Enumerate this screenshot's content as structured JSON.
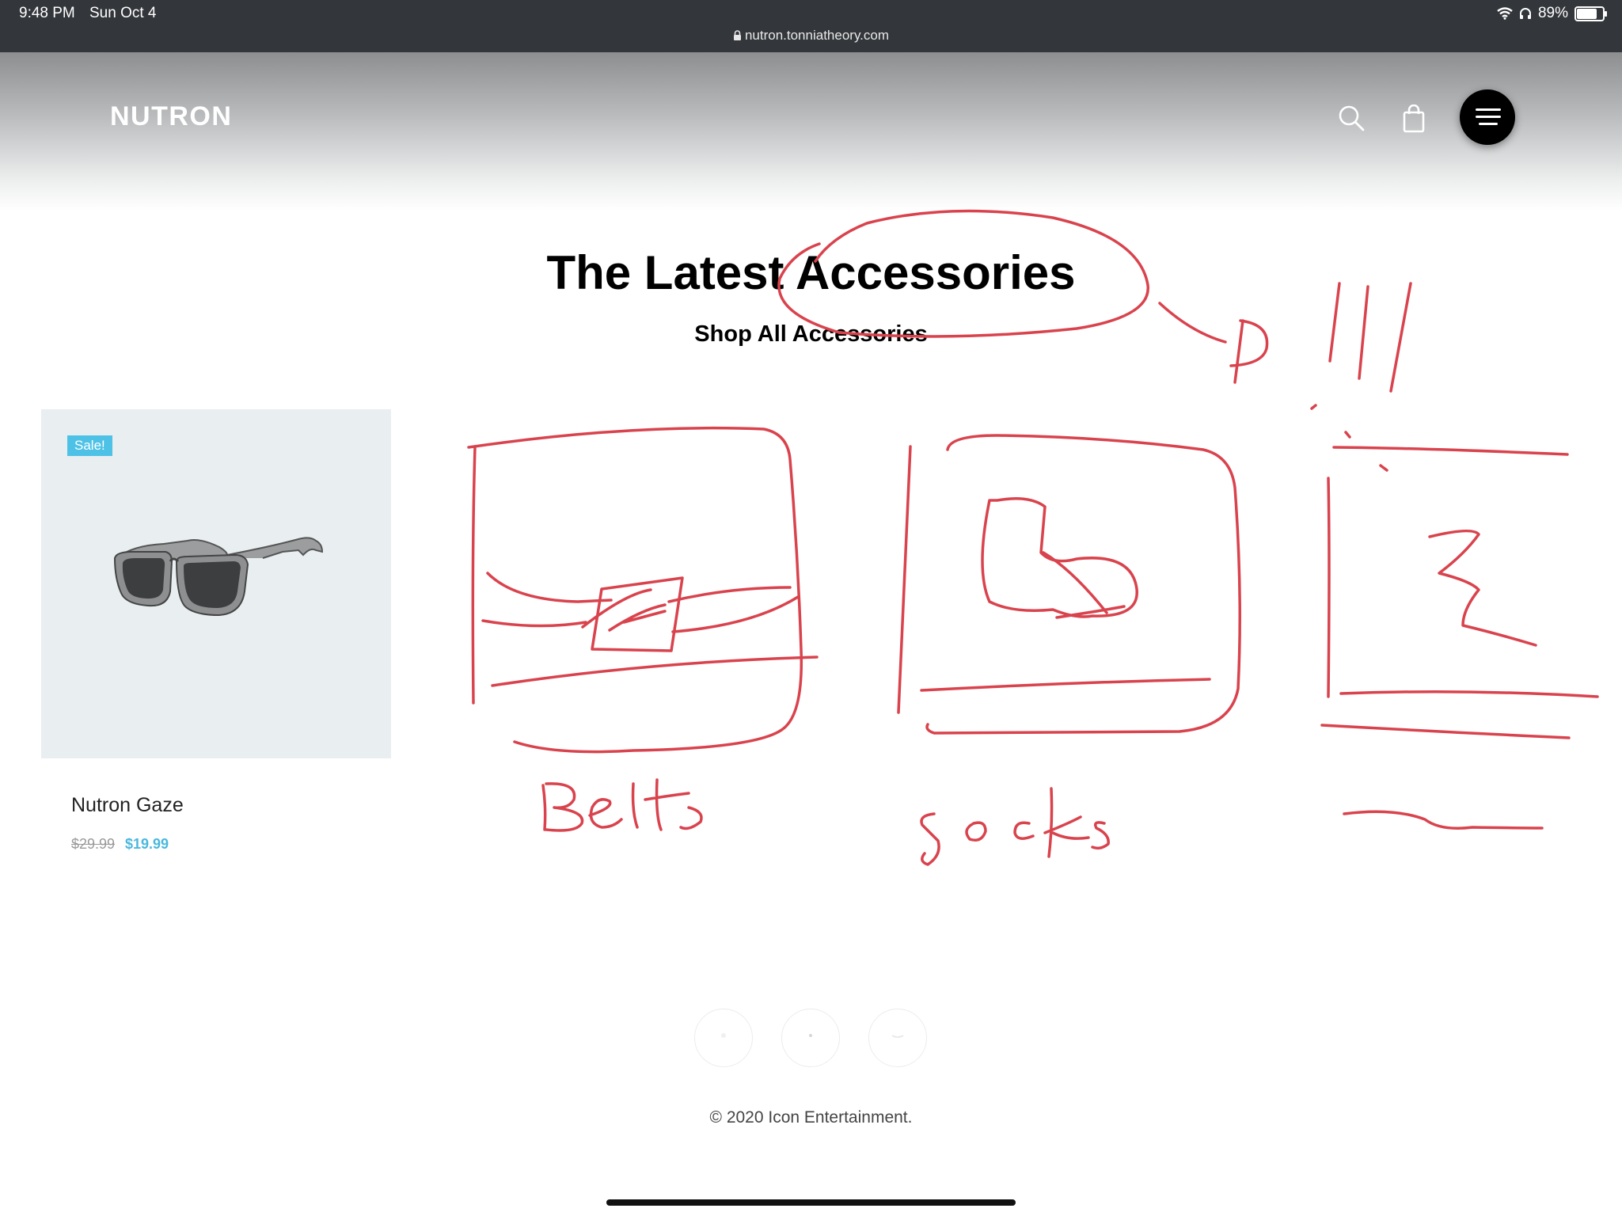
{
  "status_bar": {
    "time": "9:48 PM",
    "date": "Sun Oct 4",
    "url": "nutron.tonniatheory.com",
    "battery": "89%",
    "battery_level": 0.89
  },
  "header": {
    "logo": "NUTRON"
  },
  "main": {
    "title": "The Latest Accessories",
    "subtitle": "Shop All Accessories"
  },
  "product": {
    "badge": "Sale!",
    "name": "Nutron Gaze",
    "old_price": "$29.99",
    "new_price": "$19.99"
  },
  "footer": {
    "copyright": "© 2020 Icon Entertainment."
  },
  "annotations": {
    "sketch_color": "#d9434d",
    "handwritten_labels": [
      "Belts",
      "socks"
    ]
  },
  "colors": {
    "status_bar_bg": "#33363a",
    "sale_badge": "#4ec2e6",
    "sale_price": "#4ab8de",
    "card_bg": "#e9eef1"
  }
}
